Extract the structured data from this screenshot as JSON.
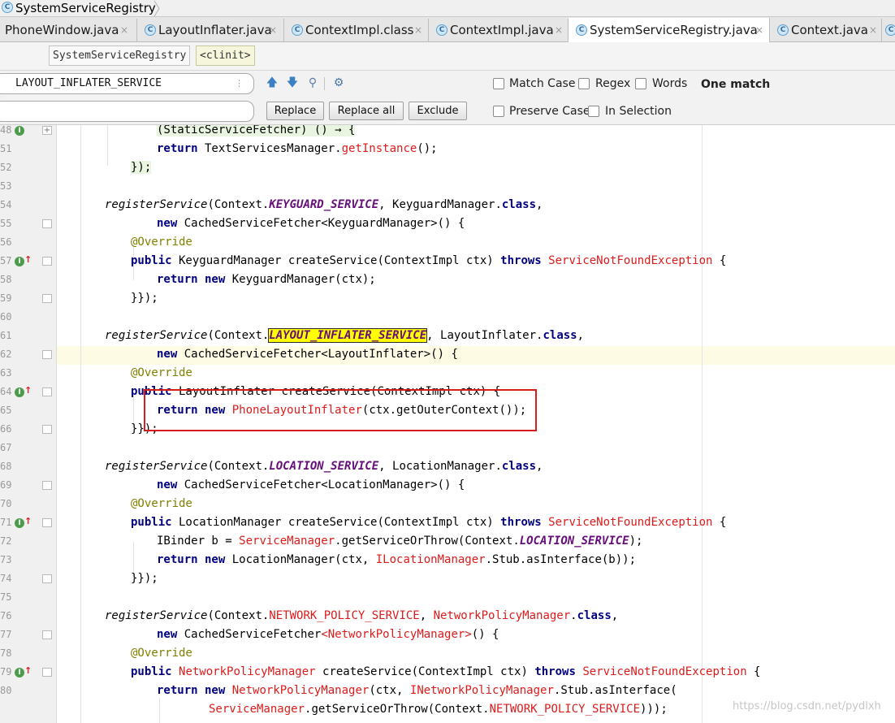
{
  "breadcrumb": {
    "title": "SystemServiceRegistry"
  },
  "tabs": [
    {
      "label": "PhoneWindow.java",
      "close": "×",
      "active": false,
      "icon": "class-icon"
    },
    {
      "label": "LayoutInflater.java",
      "close": "×",
      "active": false,
      "icon": "class-icon"
    },
    {
      "label": "ContextImpl.class",
      "close": "×",
      "active": false,
      "icon": "class-icon"
    },
    {
      "label": "ContextImpl.java",
      "close": "×",
      "active": false,
      "icon": "class-icon"
    },
    {
      "label": "SystemServiceRegistry.java",
      "close": "×",
      "active": true,
      "icon": "class-icon"
    },
    {
      "label": "Context.java",
      "close": "×",
      "active": false,
      "icon": "class-icon"
    }
  ],
  "structure": {
    "class_name": "SystemServiceRegistry",
    "member": "<clinit>"
  },
  "find": {
    "search_value": "LAYOUT_INFLATER_SERVICE",
    "replace_value": "",
    "buttons": {
      "replace": "Replace",
      "replace_all": "Replace all",
      "exclude": "Exclude"
    },
    "options": {
      "match_case": "Match Case",
      "regex": "Regex",
      "words": "Words",
      "preserve_case": "Preserve Case",
      "in_selection": "In Selection"
    },
    "status": "One match"
  },
  "editor": {
    "line_numbers": [
      "48",
      "51",
      "52",
      "53",
      "54",
      "55",
      "56",
      "57",
      "58",
      "59",
      "60",
      "61",
      "62",
      "63",
      "64",
      "65",
      "66",
      "67",
      "68",
      "69",
      "70",
      "71",
      "72",
      "73",
      "74",
      "75",
      "76",
      "77",
      "78",
      "79",
      "80"
    ],
    "current_line": "62",
    "code": {
      "l48a": "(StaticServiceFetcher) () → {",
      "l51a": "return",
      "l51b": " TextServicesManager.",
      "l51c": "getInstance",
      "l51d": "();",
      "l52a": "});",
      "l54a": "registerService",
      "l54b": "(Context.",
      "l54c": "KEYGUARD_SERVICE",
      "l54d": ", KeyguardManager.",
      "l54e": "class",
      "l54f": ",",
      "l55a": "new",
      "l55b": " CachedServiceFetcher<KeyguardManager>() {",
      "l56a": "@Override",
      "l57a": "public",
      "l57b": " KeyguardManager createService(ContextImpl ctx) ",
      "l57c": "throws",
      "l57d": " ",
      "l57e": "ServiceNotFoundException",
      "l57f": " {",
      "l58a": "return new",
      "l58b": " KeyguardManager(ctx);",
      "l59a": "}});",
      "l61a": "registerService",
      "l61b": "(Context.",
      "l61c": "LAYOUT_INFLATER_SERVICE",
      "l61d": ", LayoutInflater.",
      "l61e": "class",
      "l61f": ",",
      "l62a": "new",
      "l62b": " CachedServiceFetcher<LayoutInflater>() {",
      "l63a": "@Override",
      "l64a": "public",
      "l64b": " LayoutInflater createService(ContextImpl ctx) {",
      "l65a": "return new",
      "l65b": " ",
      "l65c": "PhoneLayoutInflater",
      "l65d": "(ctx.getOuterContext());",
      "l66a": "}});",
      "l68a": "registerService",
      "l68b": "(Context.",
      "l68c": "LOCATION_SERVICE",
      "l68d": ", LocationManager.",
      "l68e": "class",
      "l68f": ",",
      "l69a": "new",
      "l69b": " CachedServiceFetcher<LocationManager>() {",
      "l70a": "@Override",
      "l71a": "public",
      "l71b": " LocationManager createService(ContextImpl ctx) ",
      "l71c": "throws",
      "l71d": " ",
      "l71e": "ServiceNotFoundException",
      "l71f": " {",
      "l72a": "IBinder b = ",
      "l72b": "ServiceManager",
      "l72c": ".getServiceOrThrow(Context.",
      "l72d": "LOCATION_SERVICE",
      "l72e": ");",
      "l73a": "return new",
      "l73b": " LocationManager(ctx, ",
      "l73c": "ILocationManager",
      "l73d": ".Stub.asInterface(b));",
      "l74a": "}});",
      "l76a": "registerService",
      "l76b": "(Context.",
      "l76c": "NETWORK_POLICY_SERVICE",
      "l76d": ", ",
      "l76e": "NetworkPolicyManager",
      "l76f": ".",
      "l76g": "class",
      "l76h": ",",
      "l77a": "new",
      "l77b": " CachedServiceFetcher",
      "l77c": "<NetworkPolicyManager>",
      "l77d": "() {",
      "l78a": "@Override",
      "l79a": "public",
      "l79b": " ",
      "l79c": "NetworkPolicyManager",
      "l79d": " createService(ContextImpl ctx) ",
      "l79e": "throws",
      "l79f": " ",
      "l79g": "ServiceNotFoundException",
      "l79h": " {",
      "l80a": "return new",
      "l80b": " ",
      "l80c": "NetworkPolicyManager",
      "l80d": "(ctx, ",
      "l80e": "INetworkPolicyManager",
      "l80f": ".Stub.asInterface(",
      "l80ga": "ServiceManager",
      "l80gb": ".getServiceOrThrow(Context.",
      "l80gc": "NETWORK_POLICY_SERVICE",
      "l80gd": ")));"
    }
  },
  "watermark": "https://blog.csdn.net/pydlxh",
  "colors": {
    "keyword": "#000080",
    "static_field": "#660e7a",
    "annotation": "#808000",
    "error": "#dd1b1b",
    "search_match": "#ffff00",
    "callout_box": "#d51d1d"
  }
}
